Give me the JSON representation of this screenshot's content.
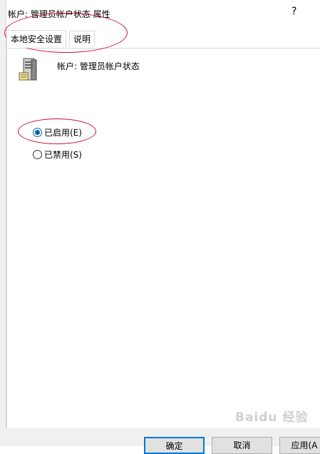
{
  "window": {
    "title": "帐户: 管理员帐户状态 属性",
    "help_label": "?"
  },
  "tabs": [
    {
      "label": "本地安全设置",
      "active": true
    },
    {
      "label": "说明",
      "active": false
    }
  ],
  "policy": {
    "icon": "server-icon",
    "name": "帐户: 管理员帐户状态"
  },
  "options": [
    {
      "label": "已启用(E)",
      "checked": true
    },
    {
      "label": "已禁用(S)",
      "checked": false
    }
  ],
  "buttons": {
    "ok": "确定",
    "cancel": "取消",
    "apply": "应用(A"
  },
  "watermark": "Baidu 经验",
  "colors": {
    "annotation": "#c8102e",
    "radio_selected": "#0063b1",
    "ok_border": "#0078d7"
  }
}
